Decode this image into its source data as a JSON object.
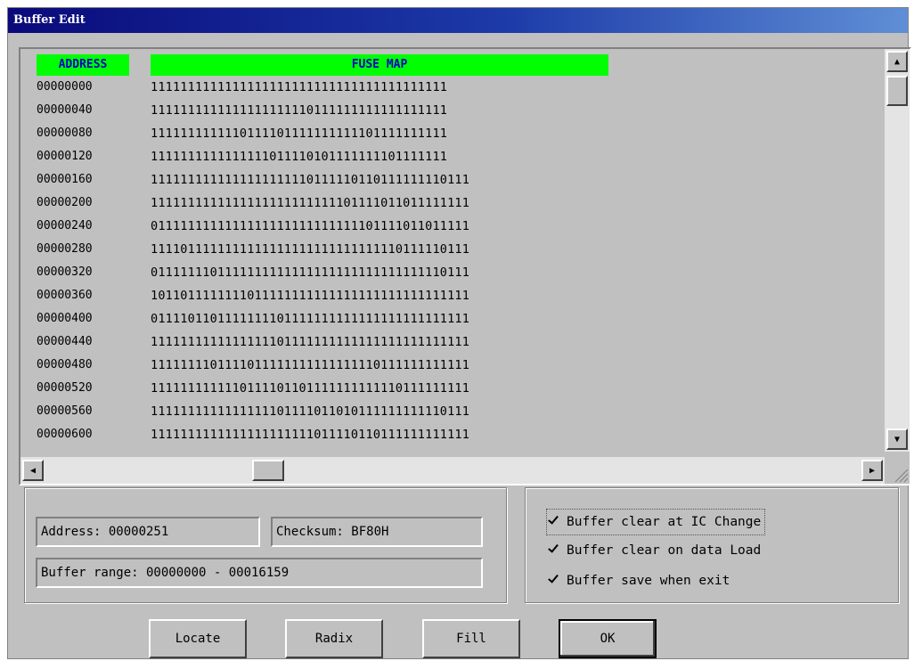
{
  "window": {
    "title": "Buffer Edit"
  },
  "table": {
    "address_header": "ADDRESS",
    "fuse_header": "FUSE MAP",
    "rows": [
      {
        "address": "00000000",
        "bits": "1111111111111111111111111111111111111111"
      },
      {
        "address": "00000040",
        "bits": "1111111111111111111110111111111111111111"
      },
      {
        "address": "00000080",
        "bits": "1111111111110111101111111111101111111111"
      },
      {
        "address": "00000120",
        "bits": "1111111111111111011110101111111101111111"
      },
      {
        "address": "00000160",
        "bits": "1111111111111111111110111110110111111110111"
      },
      {
        "address": "00000200",
        "bits": "1111111111111111111111111101111011011111111"
      },
      {
        "address": "00000240",
        "bits": "0111111111111111111111111111101111011011111"
      },
      {
        "address": "00000280",
        "bits": "1111011111111111111111111111111110111110111"
      },
      {
        "address": "00000320",
        "bits": "0111111101111111111111111111111111111110111"
      },
      {
        "address": "00000360",
        "bits": "1011011111111011111111111111111111111111111"
      },
      {
        "address": "00000400",
        "bits": "0111101101111111101111111111111111111111111"
      },
      {
        "address": "00000440",
        "bits": "1111111111111111101111111111111111111111111"
      },
      {
        "address": "00000480",
        "bits": "1111111101111011111111111111110111111111111"
      },
      {
        "address": "00000520",
        "bits": "1111111111110111101101111111111110111111111"
      },
      {
        "address": "00000560",
        "bits": "1111111111111111101111011010111111111110111"
      },
      {
        "address": "00000600",
        "bits": "1111111111111111111111011110110111111111111"
      }
    ]
  },
  "info": {
    "address": "Address: 00000251",
    "checksum": "Checksum: BF80H",
    "range": "Buffer range: 00000000 - 00016159"
  },
  "options": [
    {
      "label": "Buffer clear at IC Change",
      "checked": true
    },
    {
      "label": "Buffer clear on data Load",
      "checked": true
    },
    {
      "label": "Buffer save when exit",
      "checked": true
    }
  ],
  "buttons": {
    "locate": "Locate",
    "radix": "Radix",
    "fill": "Fill",
    "ok": "OK"
  },
  "icons": {
    "up": "scroll-up-arrow-icon",
    "down": "scroll-down-arrow-icon",
    "left": "scroll-left-arrow-icon",
    "right": "scroll-right-arrow-icon",
    "check": "checkmark-icon"
  },
  "colors": {
    "header_bg": "#00ff00",
    "header_text": "#0000c8",
    "title_bar": "#0a0a7a"
  }
}
